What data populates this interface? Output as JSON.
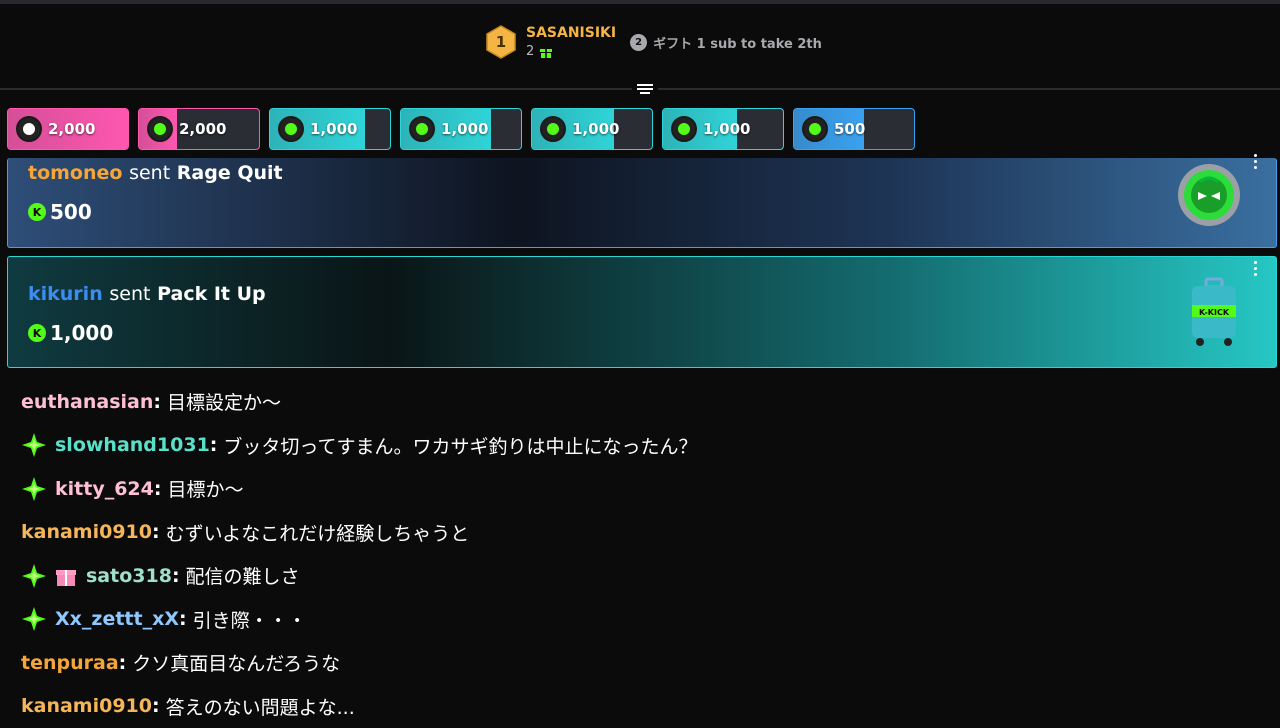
{
  "leaderboard": {
    "rank": "1",
    "top_user": "SASANISIKI",
    "top_count": "2",
    "next_rank": "2",
    "next_text": "ギフト 1 sub to take 2th"
  },
  "kick_pills": [
    {
      "amount": "2,000",
      "fill": 1.0,
      "color": "#ff57b0",
      "avatar": "#ffffff"
    },
    {
      "amount": "2,000",
      "fill": 0.32,
      "color": "#ff57b0",
      "avatar": "#53fc18"
    },
    {
      "amount": "1,000",
      "fill": 0.79,
      "color": "#2fd4d8",
      "avatar": "#53fc18"
    },
    {
      "amount": "1,000",
      "fill": 0.75,
      "color": "#2fd4d8",
      "avatar": "#53fc18"
    },
    {
      "amount": "1,000",
      "fill": 0.68,
      "color": "#2fd4d8",
      "avatar": "#53fc18"
    },
    {
      "amount": "1,000",
      "fill": 0.62,
      "color": "#2fd4d8",
      "avatar": "#53fc18"
    },
    {
      "amount": "500",
      "fill": 0.58,
      "color": "#3aa2f0",
      "avatar": "#53fc18"
    }
  ],
  "gift_cards": [
    {
      "sender": "tomoneo",
      "sender_color": "#f5a63a",
      "sent_word": "sent",
      "gift": "Rage Quit",
      "amount": "500"
    },
    {
      "sender": "kikurin",
      "sender_color": "#3d8df0",
      "sent_word": "sent",
      "gift": "Pack It Up",
      "amount": "1,000",
      "art_text": "K-KICK"
    }
  ],
  "messages": [
    {
      "user": "euthanasian",
      "color": "#ffc0d6",
      "badge": "none",
      "text": "目標設定か〜"
    },
    {
      "user": "slowhand1031",
      "color": "#5ae0c8",
      "badge": "sub-star-icon",
      "text": "ブッタ切ってすまん。ワカサギ釣りは中止になったん？"
    },
    {
      "user": "kitty_624",
      "color": "#ffc0d6",
      "badge": "sub-star-icon",
      "text": "目標か〜"
    },
    {
      "user": "kanami0910",
      "color": "#f5b55a",
      "badge": "none",
      "text": "むずいよなこれだけ経験しちゃうと"
    },
    {
      "user": "sato318",
      "color": "#9fe0c8",
      "badge": "sub-star-icon",
      "extra_badge": "gift-icon",
      "text": "配信の難しさ"
    },
    {
      "user": "Xx_zettt_xX",
      "color": "#8ec8ff",
      "badge": "sub-star-icon",
      "text": "引き際・・・"
    },
    {
      "user": "tenpuraa",
      "color": "#f5a63a",
      "badge": "none",
      "text": "クソ真面目なんだろうな"
    },
    {
      "user": "kanami0910",
      "color": "#f5b55a",
      "badge": "none",
      "text": "答えのない問題よな..."
    }
  ]
}
